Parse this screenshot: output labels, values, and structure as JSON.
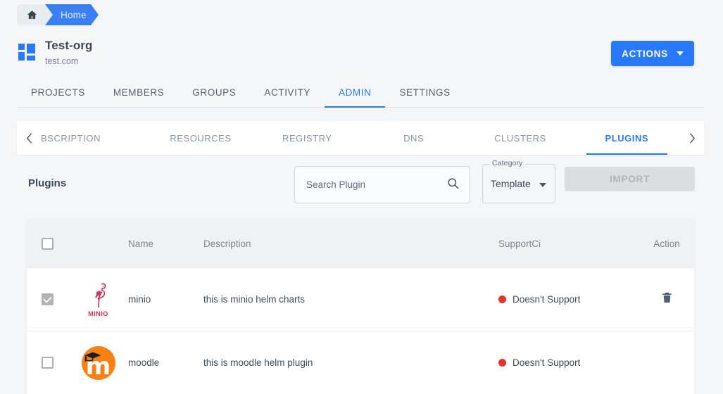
{
  "breadcrumb": {
    "home_icon": "home-icon",
    "items": [
      {
        "label": "Home"
      }
    ]
  },
  "org": {
    "logo_icon": "org-grid-icon",
    "title": "Test-org",
    "domain": "test.com",
    "actions_label": "ACTIONS",
    "actions_caret_icon": "chevron-down-icon",
    "accent_color": "#2979ff"
  },
  "tabs": [
    {
      "label": "PROJECTS",
      "active": false
    },
    {
      "label": "MEMBERS",
      "active": false
    },
    {
      "label": "GROUPS",
      "active": false
    },
    {
      "label": "ACTIVITY",
      "active": false
    },
    {
      "label": "ADMIN",
      "active": true
    },
    {
      "label": "SETTINGS",
      "active": false
    }
  ],
  "subtabs": {
    "scroll_left_icon": "chevron-left-icon",
    "scroll_right_icon": "chevron-right-icon",
    "items": [
      {
        "label": "BSCRIPTION",
        "active": false
      },
      {
        "label": "RESOURCES",
        "active": false
      },
      {
        "label": "REGISTRY",
        "active": false
      },
      {
        "label": "DNS",
        "active": false
      },
      {
        "label": "CLUSTERS",
        "active": false
      },
      {
        "label": "PLUGINS",
        "active": true
      }
    ]
  },
  "toolbar": {
    "section_title": "Plugins",
    "search": {
      "placeholder": "Search Plugin",
      "value": "",
      "icon": "search-icon"
    },
    "category": {
      "label": "Category",
      "value": "Template",
      "caret_icon": "dropdown-arrow-icon"
    },
    "import_label": "IMPORT",
    "import_disabled": true
  },
  "table": {
    "select_all_checked": false,
    "columns": [
      {
        "key": "checkbox",
        "label": ""
      },
      {
        "key": "logo",
        "label": ""
      },
      {
        "key": "name",
        "label": "Name"
      },
      {
        "key": "description",
        "label": "Description"
      },
      {
        "key": "supportci",
        "label": "SupportCi"
      },
      {
        "key": "action",
        "label": "Action"
      }
    ],
    "rows": [
      {
        "checked": true,
        "checkbox_disabled": true,
        "logo": "minio-logo",
        "logo_text": "MINIO",
        "logo_color": "#c72c48",
        "name": "minio",
        "description": "this is minio helm charts",
        "support": "Doesn't Support",
        "support_color": "#e8322c",
        "action_icon": "trash-icon",
        "action_visible": true
      },
      {
        "checked": false,
        "checkbox_disabled": false,
        "logo": "moodle-logo",
        "logo_text": "m",
        "logo_color": "#f98012",
        "name": "moodle",
        "description": "this is moodle helm plugin",
        "support": "Doesn't Support",
        "support_color": "#e8322c",
        "action_icon": "trash-icon",
        "action_visible": false
      }
    ]
  }
}
